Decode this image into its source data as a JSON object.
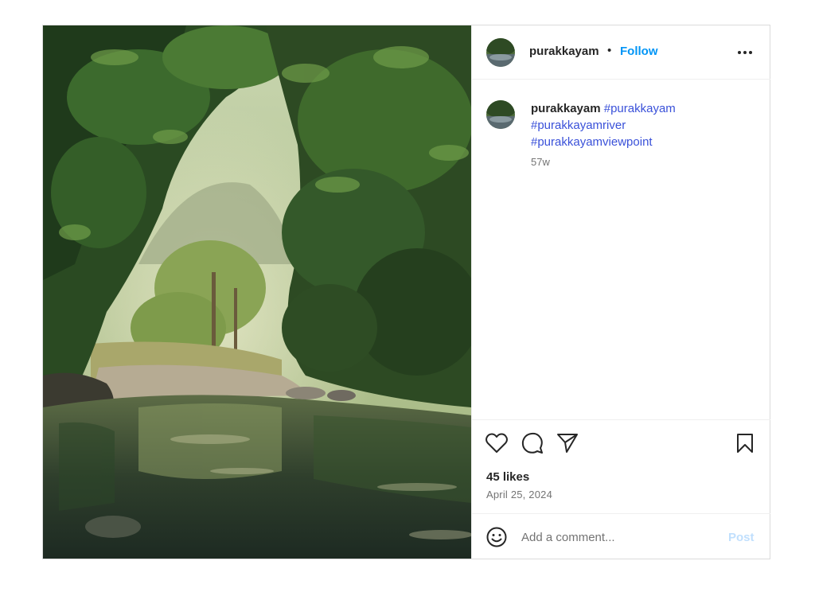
{
  "post": {
    "username": "purakkayam",
    "separator": "•",
    "follow_label": "Follow",
    "more_icon": "more-horizontal-icon",
    "caption": {
      "username": "purakkayam",
      "hashtags": [
        "#purakkayam",
        "#purakkayamriver",
        "#purakkayamviewpoint"
      ],
      "age": "57w"
    },
    "likes": "45 likes",
    "date": "April 25, 2024",
    "comment": {
      "placeholder": "Add a comment...",
      "post_label": "Post"
    },
    "icons": {
      "like": "heart-icon",
      "comment": "comment-icon",
      "share": "send-icon",
      "save": "bookmark-icon",
      "emoji": "emoji-icon"
    },
    "colors": {
      "accent": "#0095f6",
      "hashtag": "#3a51d9",
      "post_disabled": "#c0dffd",
      "muted": "#737373",
      "border": "#dbdbdb"
    }
  }
}
